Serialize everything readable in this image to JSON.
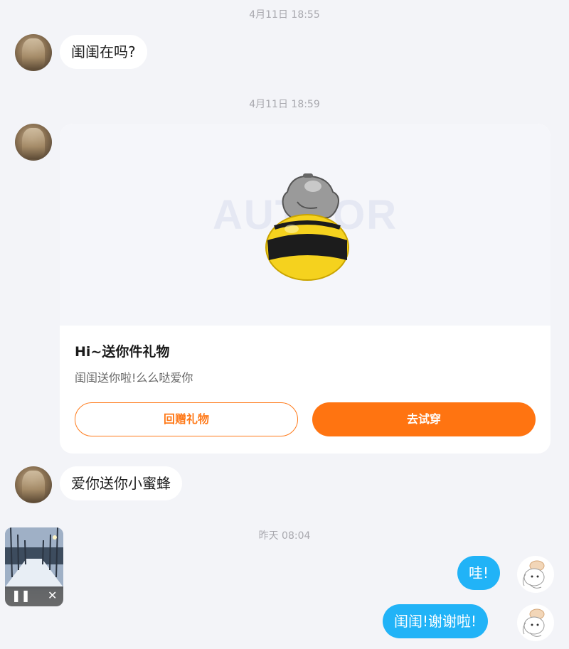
{
  "timestamps": {
    "t1": "4月11日 18:55",
    "t2": "4月11日 18:59",
    "t3": "昨天 08:04"
  },
  "messages": {
    "m1": "闺闺在吗?",
    "m2": "爱你送你小蜜蜂",
    "m3": "哇!",
    "m4": "闺闺!谢谢啦!"
  },
  "gift_card": {
    "watermark": "AUTHOR",
    "title": "Hi~送你件礼物",
    "subtitle": "闺闺送你啦!么么哒爱你",
    "return_label": "回赠礼物",
    "try_label": "去试穿"
  },
  "mini_player": {
    "pause_icon": "pause-icon",
    "close_icon": "close-icon"
  },
  "colors": {
    "accent_orange": "#ff7411",
    "my_bubble_blue": "#21b3f7"
  }
}
